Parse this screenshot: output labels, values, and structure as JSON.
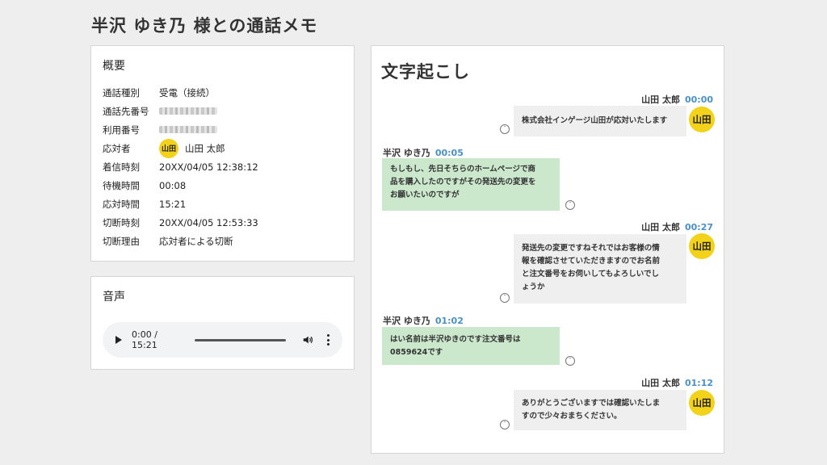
{
  "page": {
    "title": "半沢 ゆき乃 様との通話メモ"
  },
  "summary": {
    "title": "概要",
    "rows": [
      {
        "key": "通話種別",
        "value": "受電（接続）"
      },
      {
        "key": "通話先番号",
        "value": ""
      },
      {
        "key": "利用番号",
        "value": ""
      },
      {
        "key": "応対者",
        "value": "山田 太郎",
        "avatar": "山田"
      },
      {
        "key": "着信時刻",
        "value": "20XX/04/05 12:38:12"
      },
      {
        "key": "待機時間",
        "value": "00:08"
      },
      {
        "key": "応対時間",
        "value": "15:21"
      },
      {
        "key": "切断時刻",
        "value": "20XX/04/05 12:53:33"
      },
      {
        "key": "切断理由",
        "value": "応対者による切断"
      }
    ]
  },
  "audio": {
    "title": "音声",
    "time": "0:00 / 15:21",
    "icons": [
      "play-icon",
      "volume-icon",
      "more-icon"
    ]
  },
  "transcript": {
    "title": "文字起こし",
    "messages": [
      {
        "speaker": "山田 太郎",
        "time": "00:00",
        "side": "agent",
        "avatar": "山田",
        "lines": [
          "株式会社インゲージ山田が応対いたします"
        ]
      },
      {
        "speaker": "半沢 ゆき乃",
        "time": "00:05",
        "side": "customer",
        "lines": [
          "もしもし、先日そちらのホームページで商",
          "品を購入したのですがその発送先の変更を",
          "お願いたいのですが"
        ]
      },
      {
        "speaker": "山田 太郎",
        "time": "00:27",
        "side": "agent",
        "avatar": "山田",
        "lines": [
          "発送先の変更ですねそれではお客様の情",
          "報を確認させていただきますのでお名前",
          "と注文番号をお伺いしてもよろしいでし",
          "ょうか"
        ]
      },
      {
        "speaker": "半沢 ゆき乃",
        "time": "01:02",
        "side": "customer",
        "lines": [
          "はい名前は半沢ゆきのです注文番号は",
          "0859624です"
        ]
      },
      {
        "speaker": "山田 太郎",
        "time": "01:12",
        "side": "agent",
        "avatar": "山田",
        "lines": [
          "ありがとうございますでは確認いたしま",
          "すので少々おまちください。"
        ]
      }
    ]
  }
}
